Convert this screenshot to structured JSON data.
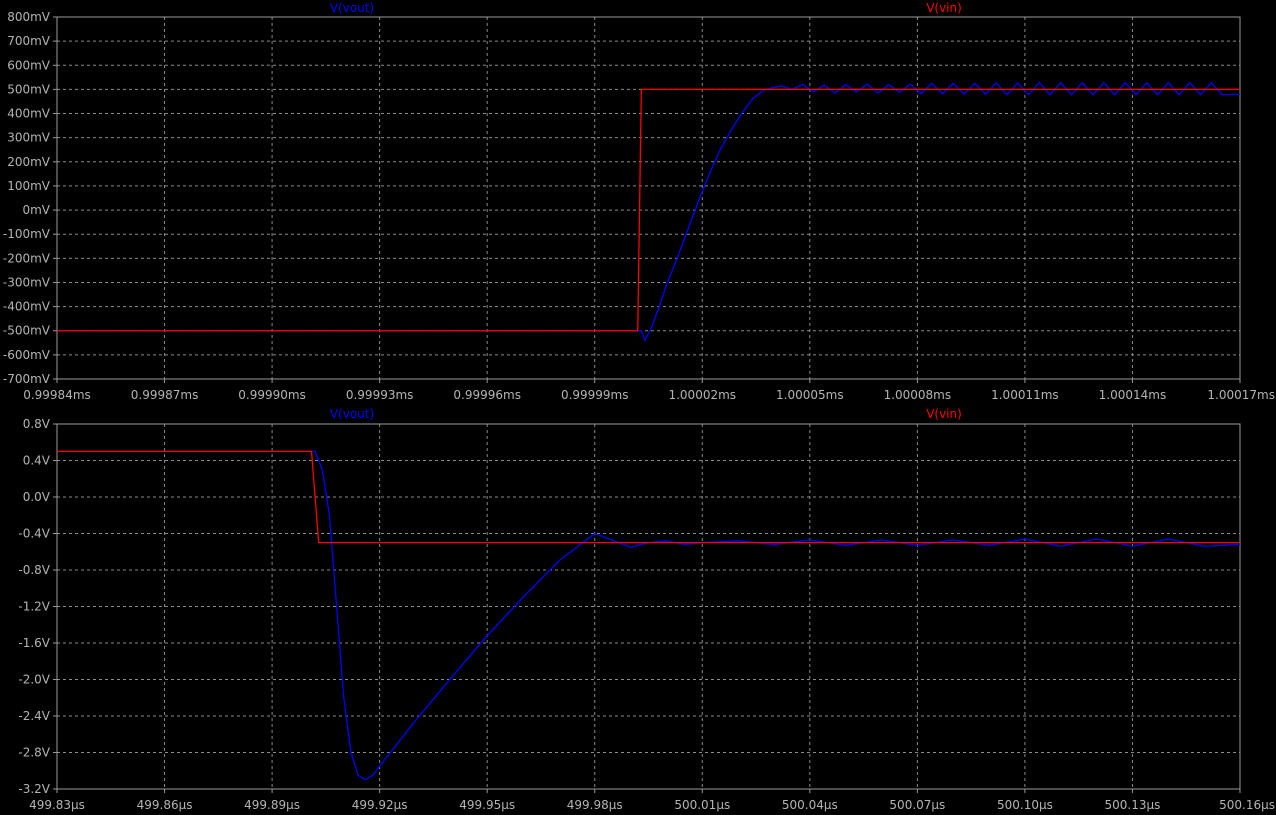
{
  "chart_data": [
    {
      "type": "line",
      "x_unit": "ms",
      "x_ticks": [
        "0.99984ms",
        "0.99987ms",
        "0.99990ms",
        "0.99993ms",
        "0.99996ms",
        "0.99999ms",
        "1.00002ms",
        "1.00005ms",
        "1.00008ms",
        "1.00011ms",
        "1.00014ms",
        "1.00017ms"
      ],
      "y_ticks": [
        "800mV",
        "700mV",
        "600mV",
        "500mV",
        "400mV",
        "300mV",
        "200mV",
        "100mV",
        "0mV",
        "-100mV",
        "-200mV",
        "-300mV",
        "-400mV",
        "-500mV",
        "-600mV",
        "-700mV"
      ],
      "xlim": [
        0.99984,
        1.00017
      ],
      "ylim": [
        -700,
        800
      ],
      "y_unit": "mV",
      "grid": true,
      "legend_placement": "top",
      "series": [
        {
          "name": "V(vout)",
          "color": "#0000ff",
          "x": [
            0.99984,
            1.000003,
            1.000004,
            1.000006,
            1.000008,
            1.00001,
            1.000013,
            1.000016,
            1.000019,
            1.000022,
            1.000025,
            1.000028,
            1.000031,
            1.000034,
            1.000037,
            1.000039,
            1.000042,
            1.000045,
            1.000048,
            1.000051,
            1.000054,
            1.000057,
            1.00006,
            1.000063,
            1.000066,
            1.000069,
            1.000072,
            1.000075,
            1.000078,
            1.000081,
            1.000084,
            1.000087,
            1.00009,
            1.000093,
            1.000096,
            1.000099,
            1.000102,
            1.000105,
            1.000108,
            1.000111,
            1.000114,
            1.000117,
            1.00012,
            1.000123,
            1.000126,
            1.000129,
            1.000132,
            1.000135,
            1.000138,
            1.000141,
            1.000144,
            1.000147,
            1.00015,
            1.000153,
            1.000156,
            1.000159,
            1.000162,
            1.000165,
            1.00017
          ],
          "y": [
            -500,
            -500,
            -540,
            -480,
            -400,
            -310,
            -200,
            -80,
            40,
            150,
            250,
            330,
            400,
            460,
            495,
            505,
            515,
            500,
            520,
            490,
            518,
            485,
            520,
            490,
            522,
            485,
            520,
            488,
            522,
            482,
            525,
            482,
            525,
            480,
            525,
            480,
            527,
            478,
            527,
            478,
            528,
            478,
            528,
            478,
            528,
            478,
            528,
            478,
            528,
            478,
            528,
            478,
            528,
            478,
            528,
            478,
            528,
            478,
            480
          ]
        },
        {
          "name": "V(vin)",
          "color": "#ff0000",
          "x": [
            0.99984,
            1.000002,
            1.000003,
            1.000004,
            1.00017
          ],
          "y": [
            -500,
            -500,
            500,
            500,
            500
          ]
        }
      ]
    },
    {
      "type": "line",
      "x_unit": "µs",
      "x_ticks": [
        "499.83µs",
        "499.86µs",
        "499.89µs",
        "499.92µs",
        "499.95µs",
        "499.98µs",
        "500.01µs",
        "500.04µs",
        "500.07µs",
        "500.10µs",
        "500.13µs",
        "500.16µs"
      ],
      "y_ticks": [
        "0.8V",
        "0.4V",
        "0.0V",
        "-0.4V",
        "-0.8V",
        "-1.2V",
        "-1.6V",
        "-2.0V",
        "-2.4V",
        "-2.8V",
        "-3.2V"
      ],
      "xlim": [
        499.83,
        500.16
      ],
      "ylim": [
        -3.2,
        0.8
      ],
      "y_unit": "V",
      "grid": true,
      "legend_placement": "top",
      "series": [
        {
          "name": "V(vout)",
          "color": "#0000ff",
          "x": [
            499.83,
            499.902,
            499.904,
            499.906,
            499.908,
            499.91,
            499.912,
            499.914,
            499.916,
            499.918,
            499.92,
            499.925,
            499.93,
            499.94,
            499.95,
            499.96,
            499.97,
            499.98,
            499.99,
            499.995,
            500.0,
            500.005,
            500.01,
            500.02,
            500.03,
            500.04,
            500.05,
            500.06,
            500.07,
            500.08,
            500.09,
            500.1,
            500.11,
            500.12,
            500.13,
            500.14,
            500.15,
            500.16
          ],
          "y": [
            0.5,
            0.5,
            0.3,
            -0.2,
            -1.2,
            -2.2,
            -2.8,
            -3.05,
            -3.1,
            -3.05,
            -2.95,
            -2.7,
            -2.45,
            -1.98,
            -1.52,
            -1.1,
            -0.7,
            -0.4,
            -0.55,
            -0.5,
            -0.48,
            -0.52,
            -0.5,
            -0.48,
            -0.52,
            -0.47,
            -0.53,
            -0.47,
            -0.53,
            -0.47,
            -0.53,
            -0.46,
            -0.54,
            -0.46,
            -0.54,
            -0.46,
            -0.54,
            -0.52
          ]
        },
        {
          "name": "V(vin)",
          "color": "#ff0000",
          "x": [
            499.83,
            499.901,
            499.903,
            500.16
          ],
          "y": [
            0.5,
            0.5,
            -0.5,
            -0.5
          ]
        }
      ]
    }
  ]
}
